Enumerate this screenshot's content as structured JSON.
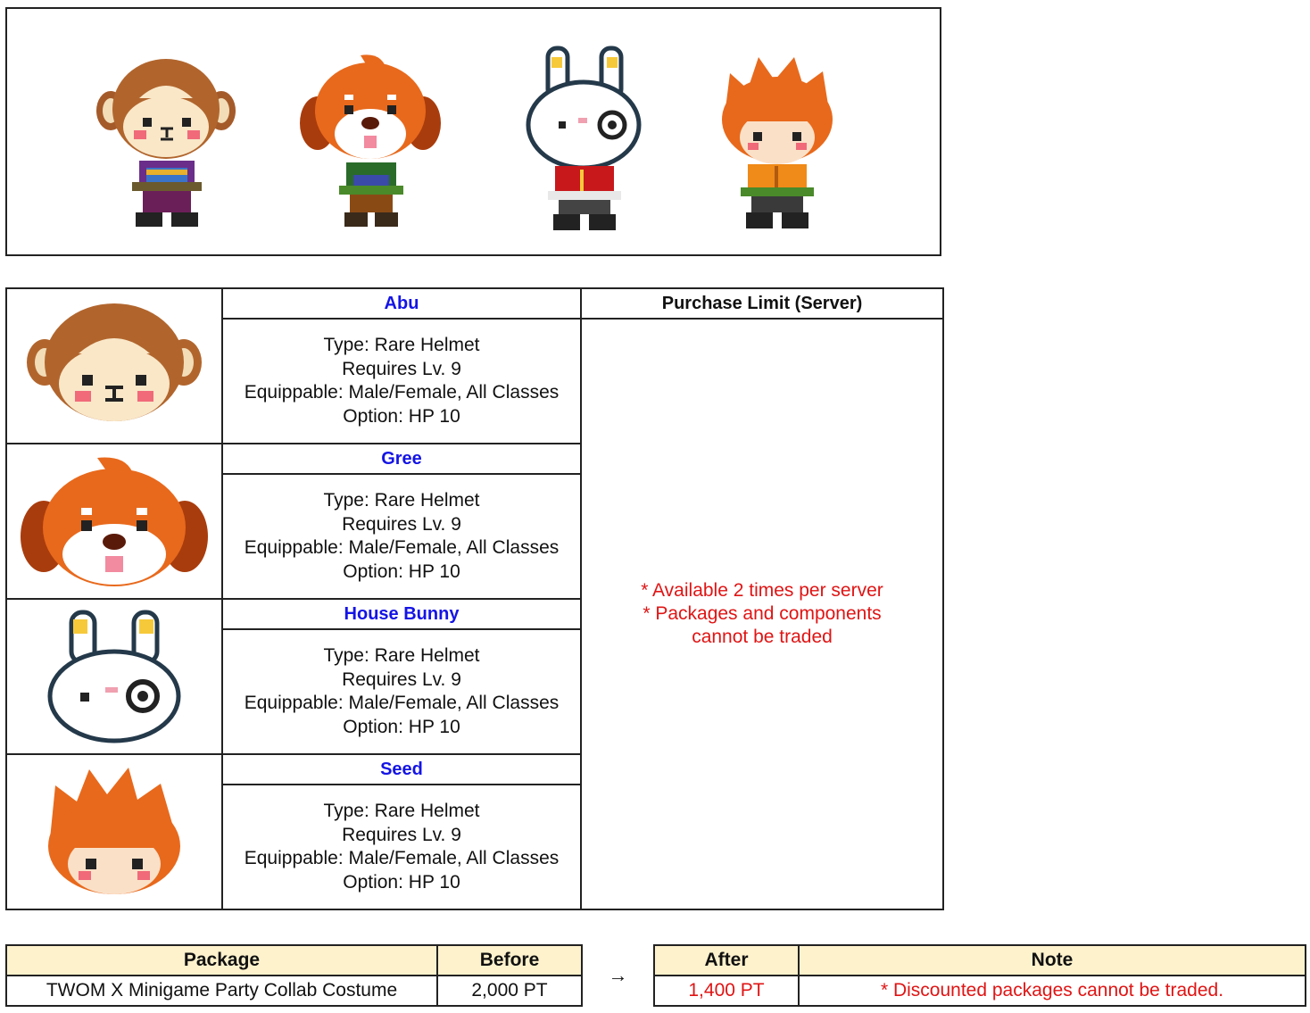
{
  "banner": {
    "characters": [
      {
        "name": "Abu",
        "icon": "abu-monkey-character-icon"
      },
      {
        "name": "Gree",
        "icon": "gree-dog-character-icon"
      },
      {
        "name": "House Bunny",
        "icon": "house-bunny-character-icon"
      },
      {
        "name": "Seed",
        "icon": "seed-flame-character-icon"
      }
    ]
  },
  "items_table": {
    "limit_header": "Purchase Limit (Server)",
    "limit_lines": [
      "* Available 2 times per server",
      "* Packages and components",
      "cannot be traded"
    ],
    "items": [
      {
        "name": "Abu",
        "icon": "abu-helmet-icon",
        "type": "Type: Rare Helmet",
        "level": "Requires Lv. 9",
        "equip": "Equippable: Male/Female, All Classes",
        "option": "Option: HP 10"
      },
      {
        "name": "Gree",
        "icon": "gree-helmet-icon",
        "type": "Type: Rare Helmet",
        "level": "Requires Lv. 9",
        "equip": "Equippable: Male/Female, All Classes",
        "option": "Option: HP 10"
      },
      {
        "name": "House Bunny",
        "icon": "house-bunny-helmet-icon",
        "type": "Type: Rare Helmet",
        "level": "Requires Lv. 9",
        "equip": "Equippable: Male/Female, All Classes",
        "option": "Option: HP 10"
      },
      {
        "name": "Seed",
        "icon": "seed-helmet-icon",
        "type": "Type: Rare Helmet",
        "level": "Requires Lv. 9",
        "equip": "Equippable: Male/Female, All Classes",
        "option": "Option: HP 10"
      }
    ]
  },
  "price_table": {
    "headers": {
      "package": "Package",
      "before": "Before",
      "after": "After",
      "note": "Note"
    },
    "arrow": "→",
    "row": {
      "package": "TWOM X Minigame Party Collab Costume",
      "before": "2,000 PT",
      "after": "1,400 PT",
      "note": "* Discounted packages cannot be traded."
    },
    "colors": {
      "header_bg": "#fef2cc",
      "red": "#e01414",
      "name_blue": "#1414e6"
    }
  }
}
